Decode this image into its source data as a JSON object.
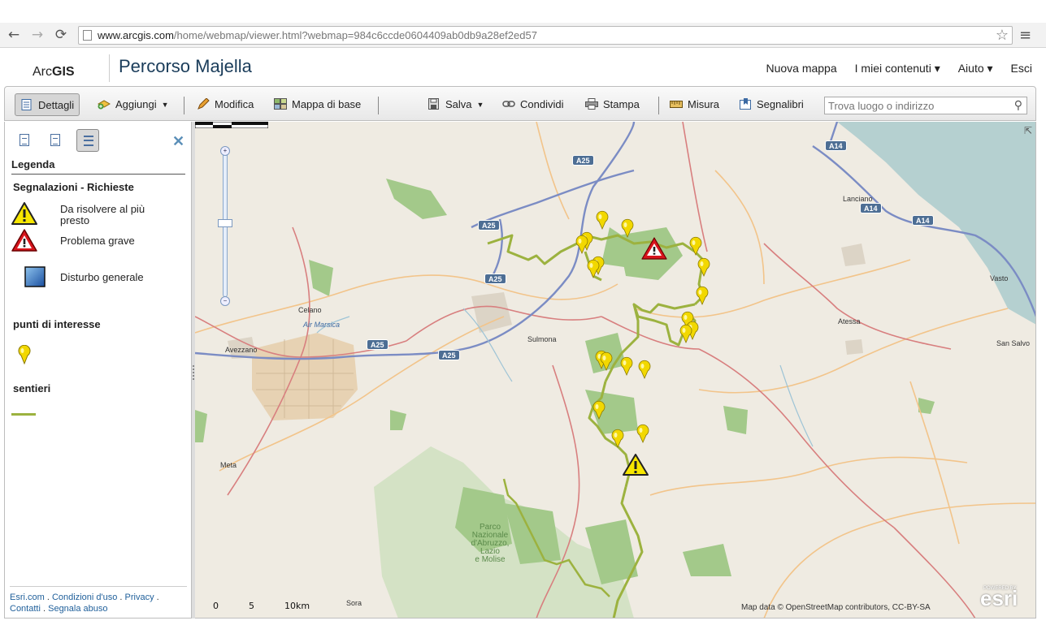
{
  "browser": {
    "url_host": "www.arcgis.com",
    "url_path": "/home/webmap/viewer.html?webmap=984c6ccde0604409ab0db9a28ef2ed57",
    "back_icon": "←",
    "forward_icon": "→",
    "reload_icon": "⟳",
    "star_icon": "☆",
    "menu_icon": "≡"
  },
  "header": {
    "logo_light": "Arc",
    "logo_bold": "GIS",
    "title": "Percorso Majella",
    "nav": [
      "Nuova mappa",
      "I miei contenuti ▾",
      "Aiuto ▾",
      "Esci"
    ]
  },
  "toolbar": {
    "details": "Dettagli",
    "add": "Aggiungi",
    "edit": "Modifica",
    "basemap": "Mappa di base",
    "save": "Salva",
    "share": "Condividi",
    "print": "Stampa",
    "measure": "Misura",
    "bookmarks": "Segnalibri",
    "search_placeholder": "Trova luogo o indirizzo"
  },
  "panel": {
    "close": "✕",
    "legend_title": "Legenda",
    "layer1_title": "Segnalazioni - Richieste",
    "layer1_items": [
      "Da risolvere al più presto",
      "Problema grave",
      "Disturbo generale"
    ],
    "layer2_title": "punti di interesse",
    "layer3_title": "sentieri",
    "footer": {
      "esri": "Esri.com",
      "terms": "Condizioni d'uso",
      "privacy": "Privacy",
      "contacts": "Contatti",
      "abuse": "Segnala abuso",
      "dot": "."
    }
  },
  "map": {
    "places": {
      "lanciano": "Lanciano",
      "vasto": "Vasto",
      "atessa": "Atessa",
      "sansalvo": "San Salvo",
      "celano": "Celano",
      "avezzano": "Avezzano",
      "sulmona": "Sulmona",
      "meta": "Meta",
      "sora": "Sora",
      "airmarsica": "Air Marsica",
      "parco": [
        "Parco",
        "Nazionale",
        "d'Abruzzo,",
        "Lazio",
        "e Molise"
      ]
    },
    "shields": {
      "a25": "A25",
      "a14": "A14"
    },
    "scale": [
      "0",
      "5",
      "10km"
    ],
    "attribution": "Map data © OpenStreetMap contributors, CC-BY-SA",
    "esri_powered": "POWERED BY",
    "esri_logo": "esri",
    "colors": {
      "trail": "#9cb23f",
      "poi": "#f2d800",
      "water": "#b5d0d0",
      "park": "#a3c98a"
    }
  }
}
